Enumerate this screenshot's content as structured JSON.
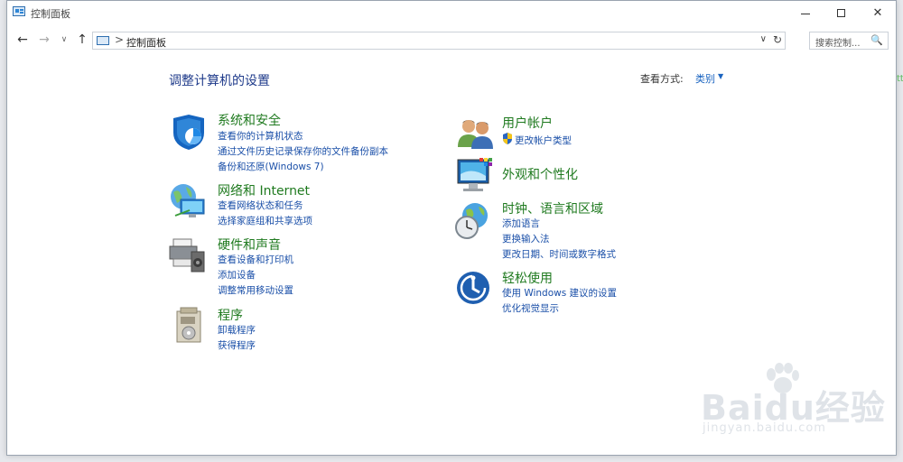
{
  "window": {
    "title": "控制面板"
  },
  "nav": {
    "address": "控制面板",
    "address_sep": ">",
    "search_placeholder": "搜索控制...",
    "back_glyph": "←",
    "forward_glyph": "→",
    "recent_glyph": "∨",
    "up_glyph": "↑",
    "dropdown_glyph": "∨",
    "refresh_glyph": "↻",
    "search_glyph": "🔍"
  },
  "main": {
    "heading": "调整计算机的设置",
    "view_by_label": "查看方式:",
    "view_by_value": "类别",
    "view_by_caret": "▼"
  },
  "categories": {
    "system": {
      "title": "系统和安全",
      "links": [
        "查看你的计算机状态",
        "通过文件历史记录保存你的文件备份副本",
        "备份和还原(Windows 7)"
      ]
    },
    "network": {
      "title": "网络和 Internet",
      "links": [
        "查看网络状态和任务",
        "选择家庭组和共享选项"
      ]
    },
    "hardware": {
      "title": "硬件和声音",
      "links": [
        "查看设备和打印机",
        "添加设备",
        "调整常用移动设置"
      ]
    },
    "programs": {
      "title": "程序",
      "links": [
        "卸载程序",
        "获得程序"
      ]
    },
    "users": {
      "title": "用户帐户",
      "links": [
        "更改帐户类型"
      ]
    },
    "appearance": {
      "title": "外观和个性化",
      "links": []
    },
    "clock": {
      "title": "时钟、语言和区域",
      "links": [
        "添加语言",
        "更换输入法",
        "更改日期、时间或数字格式"
      ]
    },
    "ease": {
      "title": "轻松使用",
      "links": [
        "使用 Windows 建议的设置",
        "优化视觉显示"
      ]
    }
  },
  "side_hint": "tt",
  "watermark": {
    "logo": "Baidu经验",
    "url": "jingyan.baidu.com"
  },
  "colors": {
    "heading": "#1e3a8a",
    "category_title": "#1f7a1f",
    "link": "#1a4fa8"
  }
}
